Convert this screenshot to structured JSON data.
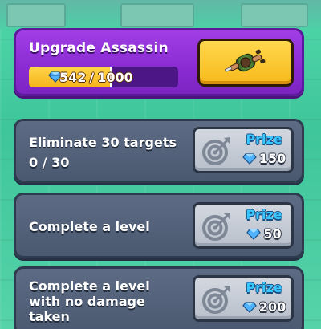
{
  "colors": {
    "upgrade_panel": "#8a2bd2",
    "mission_panel": "#55647c",
    "progress_fill": "#f5b31a",
    "prize_text": "#3bc7ff",
    "gem": "#4fb3ff",
    "background": "#4fd6a8"
  },
  "upgrade": {
    "title": "Upgrade Assassin",
    "progress_current": "542",
    "progress_separator": "/",
    "progress_total": "1000",
    "progress_fraction": 0.542,
    "character_icon": "assassin-character-icon"
  },
  "missions": [
    {
      "title_lines": [
        "Eliminate 30 targets"
      ],
      "progress": "0 / 30",
      "prize_label": "Prize",
      "prize_amount": "150"
    },
    {
      "title_lines": [
        "Complete a level"
      ],
      "progress": "",
      "prize_label": "Prize",
      "prize_amount": "50"
    },
    {
      "title_lines": [
        "Complete a level",
        "with no damage",
        "taken"
      ],
      "progress": "",
      "prize_label": "Prize",
      "prize_amount": "200"
    }
  ]
}
